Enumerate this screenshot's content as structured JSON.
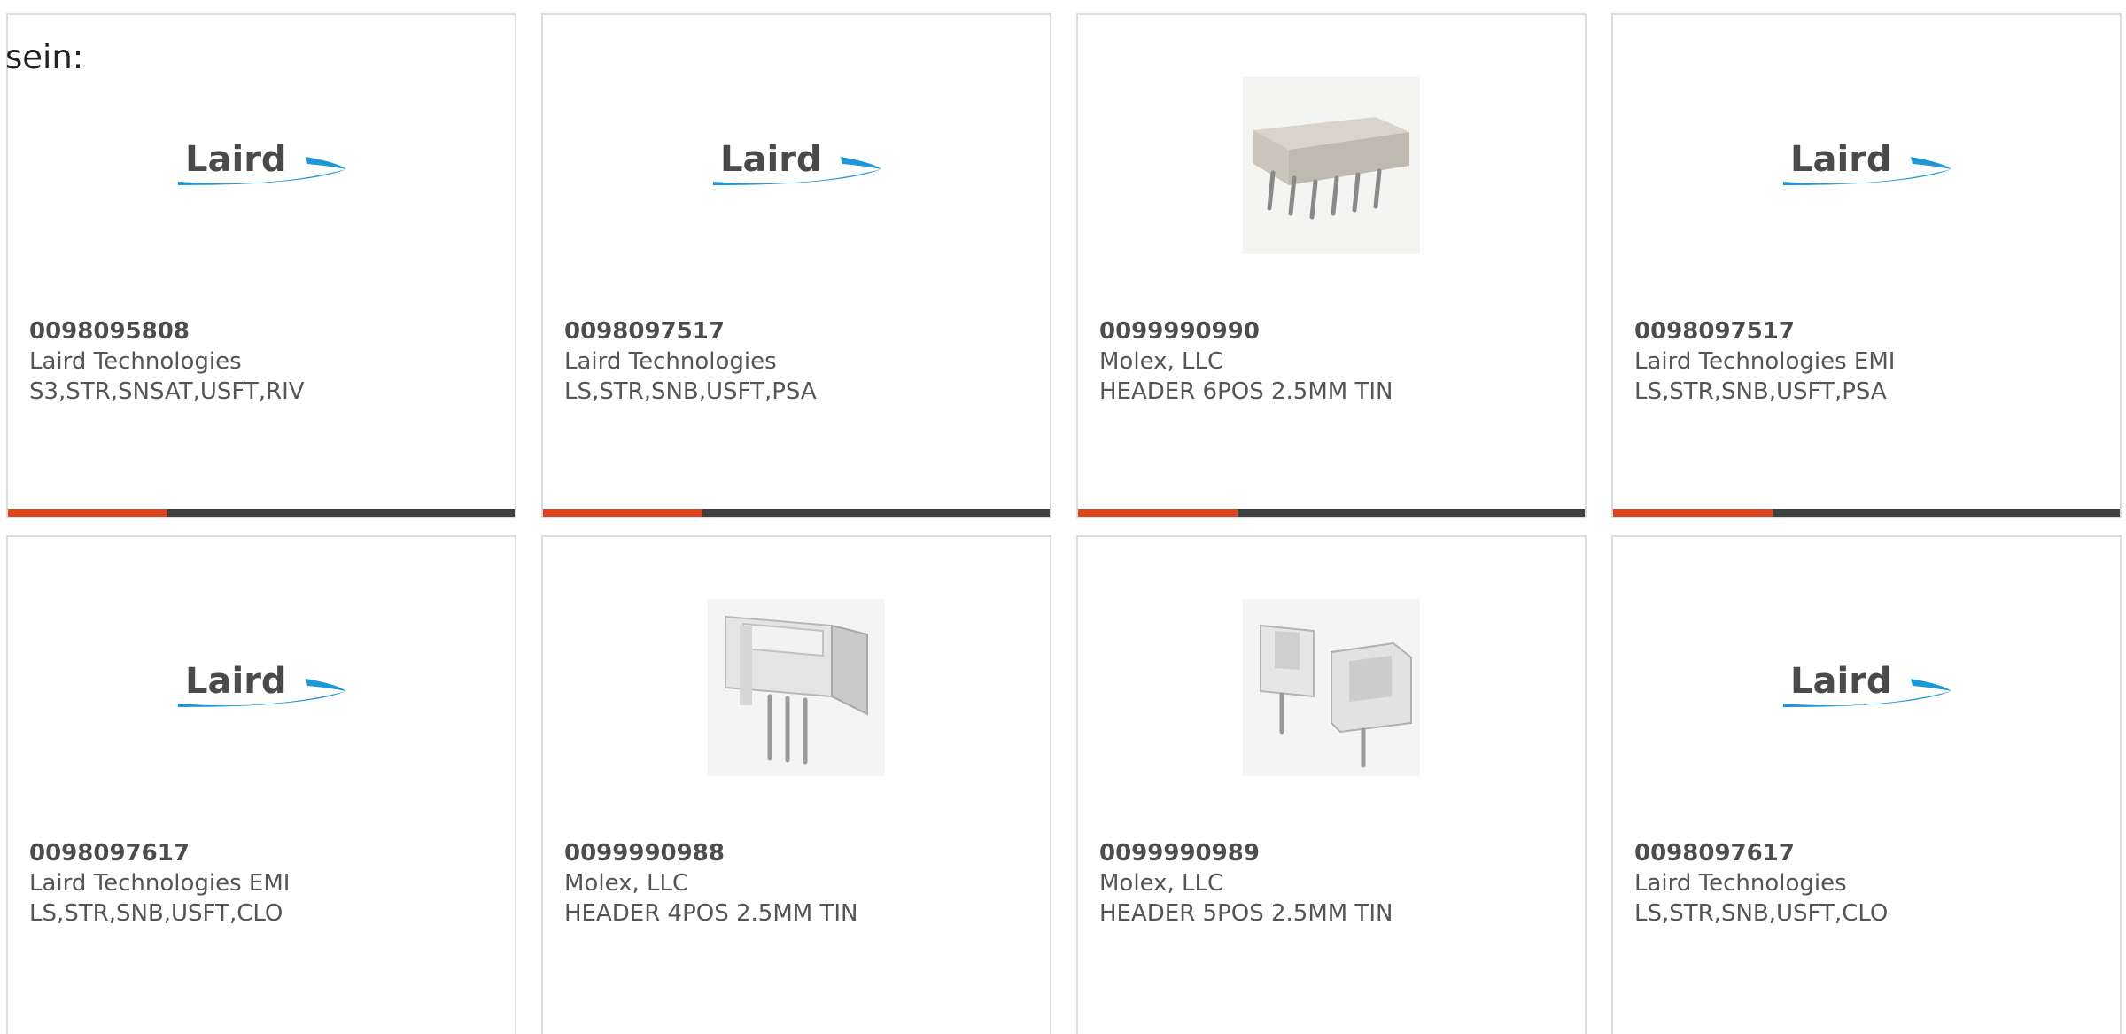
{
  "lead_text": "sein:",
  "colors": {
    "accent": "#e0441c",
    "bar": "#404040",
    "border": "#dcdcdc",
    "text": "#555555"
  },
  "cards": [
    {
      "part_number": "0098095808",
      "manufacturer": "Laird Technologies",
      "description": "S3,STR,SNSAT,USFT,RIV",
      "image": "laird-logo",
      "logo_text": "Laird"
    },
    {
      "part_number": "0098097517",
      "manufacturer": "Laird Technologies",
      "description": "LS,STR,SNB,USFT,PSA",
      "image": "laird-logo",
      "logo_text": "Laird"
    },
    {
      "part_number": "0099990990",
      "manufacturer": "Molex, LLC",
      "description": "HEADER 6POS 2.5MM TIN",
      "image": "header-connector-6pos"
    },
    {
      "part_number": "0098097517",
      "manufacturer": "Laird Technologies EMI",
      "description": "LS,STR,SNB,USFT,PSA",
      "image": "laird-logo",
      "logo_text": "Laird"
    },
    {
      "part_number": "0098097617",
      "manufacturer": "Laird Technologies EMI",
      "description": "LS,STR,SNB,USFT,CLO",
      "image": "laird-logo",
      "logo_text": "Laird"
    },
    {
      "part_number": "0099990988",
      "manufacturer": "Molex, LLC",
      "description": "HEADER 4POS 2.5MM TIN",
      "image": "header-connector-4pos"
    },
    {
      "part_number": "0099990989",
      "manufacturer": "Molex, LLC",
      "description": "HEADER 5POS 2.5MM TIN",
      "image": "header-connector-5pos"
    },
    {
      "part_number": "0098097617",
      "manufacturer": "Laird Technologies",
      "description": "LS,STR,SNB,USFT,CLO",
      "image": "laird-logo",
      "logo_text": "Laird"
    }
  ]
}
